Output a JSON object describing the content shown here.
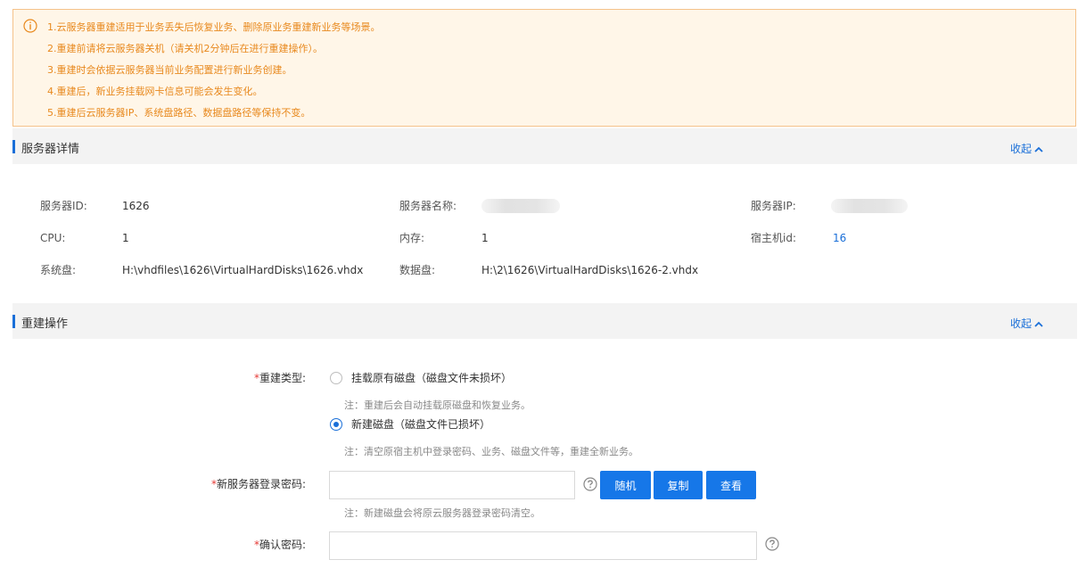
{
  "notice": {
    "lines": [
      "1.云服务器重建适用于业务丢失后恢复业务、删除原业务重建新业务等场景。",
      "2.重建前请将云服务器关机（请关机2分钟后在进行重建操作）。",
      "3.重建时会依据云服务器当前业务配置进行新业务创建。",
      "4.重建后，新业务挂载网卡信息可能会发生变化。",
      "5.重建后云服务器IP、系统盘路径、数据盘路径等保持不变。"
    ]
  },
  "details_section": {
    "title": "服务器详情",
    "collapse_label": "收起",
    "fields": {
      "server_id_label": "服务器ID:",
      "server_id_value": "1626",
      "server_name_label": "服务器名称:",
      "server_ip_label": "服务器IP:",
      "cpu_label": "CPU:",
      "cpu_value": "1",
      "memory_label": "内存:",
      "memory_value": "1",
      "host_id_label": "宿主机id:",
      "host_id_value": "16",
      "system_disk_label": "系统盘:",
      "system_disk_value": "H:\\vhdfiles\\1626\\VirtualHardDisks\\1626.vhdx",
      "data_disk_label": "数据盘:",
      "data_disk_value": "H:\\2\\1626\\VirtualHardDisks\\1626-2.vhdx"
    }
  },
  "rebuild_section": {
    "title": "重建操作",
    "collapse_label": "收起",
    "rebuild_type_label": "重建类型:",
    "required_mark": "*",
    "options": [
      {
        "label": "挂载原有磁盘（磁盘文件未损坏）",
        "note": "注：重建后会自动挂载原磁盘和恢复业务。",
        "checked": false
      },
      {
        "label": "新建磁盘（磁盘文件已损坏）",
        "note": "注：清空原宿主机中登录密码、业务、磁盘文件等，重建全新业务。",
        "checked": true
      }
    ],
    "password_label": "新服务器登录密码:",
    "password_value": "",
    "password_note": "注：新建磁盘会将原云服务器登录密码清空。",
    "buttons": {
      "random": "随机",
      "copy": "复制",
      "view": "查看"
    },
    "confirm_label": "确认密码:",
    "confirm_value": ""
  },
  "colors": {
    "accent": "#1a6fd8",
    "warning_text": "#e8891e",
    "warning_bg": "#fff6e8",
    "required": "#e53935"
  }
}
